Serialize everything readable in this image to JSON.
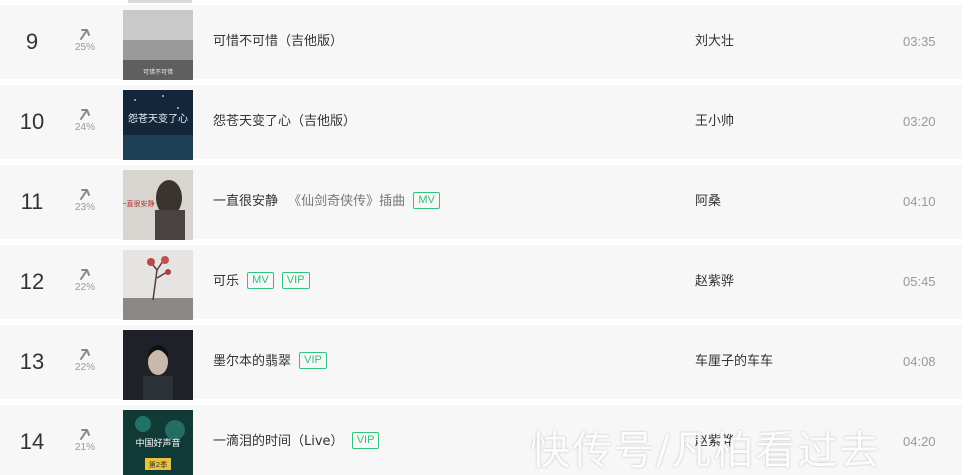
{
  "songs": [
    {
      "rank": "9",
      "trend": "25%",
      "title": "可惜不可惜（吉他版）",
      "subtitle": "",
      "badges": [],
      "artist": "刘大壮",
      "duration": "03:35",
      "cover": "gray-cover"
    },
    {
      "rank": "10",
      "trend": "24%",
      "title": "怨苍天变了心（吉他版）",
      "subtitle": "",
      "badges": [],
      "artist": "王小帅",
      "duration": "03:20",
      "cover": "night-sky-cover"
    },
    {
      "rank": "11",
      "trend": "23%",
      "title": "一直很安静",
      "subtitle": "《仙剑奇侠传》插曲",
      "badges": [
        "MV"
      ],
      "artist": "阿桑",
      "duration": "04:10",
      "cover": "portrait-cover"
    },
    {
      "rank": "12",
      "trend": "22%",
      "title": "可乐",
      "subtitle": "",
      "badges": [
        "MV",
        "VIP"
      ],
      "artist": "赵紫骅",
      "duration": "05:45",
      "cover": "tree-cover"
    },
    {
      "rank": "13",
      "trend": "22%",
      "title": "墨尔本的翡翠",
      "subtitle": "",
      "badges": [
        "VIP"
      ],
      "artist": "车厘子的车车",
      "duration": "04:08",
      "cover": "dark-portrait-cover"
    },
    {
      "rank": "14",
      "trend": "21%",
      "title": "一滴泪的时间（Live）",
      "subtitle": "",
      "badges": [
        "VIP"
      ],
      "artist": "赵紫骅",
      "duration": "04:20",
      "cover": "stage-cover"
    }
  ],
  "cover_art_text": {
    "cover_9": "可惜不可惜",
    "cover_10": "怨苍天变了心",
    "cover_11": "一直很安静",
    "cover_14_line1": "中国好声音",
    "cover_14_line2": "第2季"
  },
  "watermark": "快传号/凡柏看过去",
  "colors": {
    "row_bg": "#f7f7f7",
    "badge": "#31c27c",
    "text": "#333333",
    "muted": "#999999"
  }
}
